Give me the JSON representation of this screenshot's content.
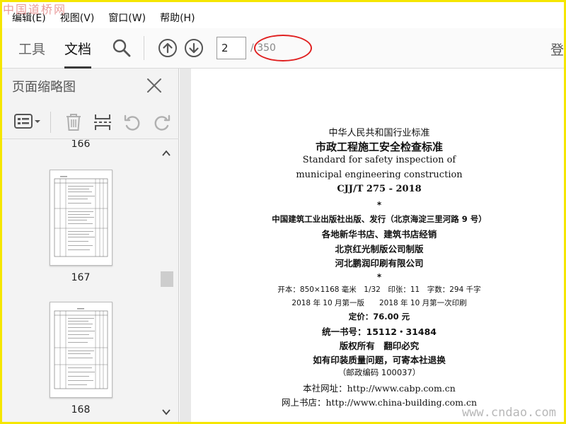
{
  "watermarks": {
    "top": "中国道桥网",
    "bottom": "www.cndao.com"
  },
  "menu": [
    "编辑(E)",
    "视图(V)",
    "窗口(W)",
    "帮助(H)"
  ],
  "toolbar": {
    "tab_tools": "工具",
    "tab_document": "文档",
    "current_page": "2",
    "total_pages": "/ 350",
    "login": "登"
  },
  "sidebar": {
    "title": "页面缩略图",
    "thumbnails": [
      {
        "page": "166"
      },
      {
        "page": "167"
      },
      {
        "page": "168"
      }
    ]
  },
  "document": {
    "lines": [
      "中华人民共和国行业标准",
      "市政工程施工安全检查标准",
      "Standard for safety inspection of",
      "municipal engineering construction",
      "CJJ/T 275 - 2018",
      "*",
      "中国建筑工业出版社出版、发行（北京海淀三里河路 9 号）",
      "各地新华书店、建筑书店经销",
      "北京红光制版公司制版",
      "河北鹏润印刷有限公司",
      "*",
      "开本：850×1168 毫米　1/32　印张：11　字数：294 千字",
      "2018 年 10 月第一版　　2018 年 10 月第一次印刷",
      "定价：76.00 元",
      "统一书号：15112・31484",
      "版权所有　翻印必究",
      "如有印装质量问题，可寄本社退换",
      "（邮政编码 100037）",
      "本社网址：http://www.cabp.com.cn",
      "网上书店：http://www.china-building.com.cn"
    ]
  },
  "colors": {
    "annotation_oval": "#e02020",
    "frame": "#f5e600",
    "tab_underline": "#3a3a3a"
  }
}
